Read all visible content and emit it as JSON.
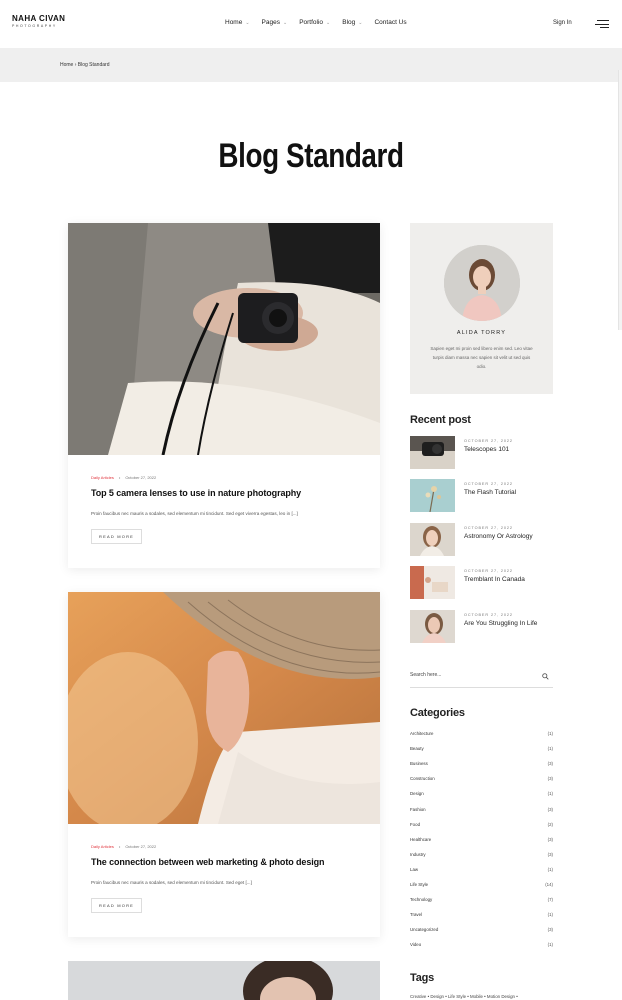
{
  "brand": {
    "name": "NAHA CIVAN",
    "tagline": "PHOTOGRAPHY"
  },
  "nav": [
    {
      "label": "Home",
      "has_dropdown": true
    },
    {
      "label": "Pages",
      "has_dropdown": true
    },
    {
      "label": "Portfolio",
      "has_dropdown": true
    },
    {
      "label": "Blog",
      "has_dropdown": true
    },
    {
      "label": "Contact Us",
      "has_dropdown": false
    }
  ],
  "header": {
    "signin_label": "Sign In",
    "menu_icon": "hamburger-icon"
  },
  "breadcrumb": "Home › Blog Standard",
  "page_title": "Blog Standard",
  "posts": [
    {
      "category": "Daily Articles",
      "date": "October 27, 2022",
      "title": "Top 5 camera lenses to use in nature photography",
      "excerpt": "Proin faucibus nec mauris a sodales, sed elementum mi tincidunt. Sed eget viverra egestas, leo in [...]",
      "read_more": "READ MORE"
    },
    {
      "category": "Daily Articles",
      "date": "October 27, 2022",
      "title": "The connection between web marketing & photo design",
      "excerpt": "Proin faucibus nec mauris a sodales, sed elementum mi tincidunt. Sed eget [...]",
      "read_more": "READ MORE"
    }
  ],
  "author": {
    "name": "ALIDA TORRY",
    "bio": "Sapien eget mi proin sed libero enim sed. Leo vitae turpis diam massa nec sapien sit velit ut sed quis odio."
  },
  "recent_heading": "Recent post",
  "recent_posts": [
    {
      "date": "OCTOBER 27, 2022",
      "title": "Telescopes 101"
    },
    {
      "date": "OCTOBER 27, 2022",
      "title": "The Flash Tutorial"
    },
    {
      "date": "OCTOBER 27, 2022",
      "title": "Astronomy Or Astrology"
    },
    {
      "date": "OCTOBER 27, 2022",
      "title": "Tremblant In Canada"
    },
    {
      "date": "OCTOBER 27, 2022",
      "title": "Are You Struggling In Life"
    }
  ],
  "search": {
    "placeholder": "Search here...",
    "icon": "search-icon"
  },
  "categories_heading": "Categories",
  "categories": [
    {
      "name": "Architecture",
      "count": "(1)"
    },
    {
      "name": "Beauty",
      "count": "(1)"
    },
    {
      "name": "Business",
      "count": "(3)"
    },
    {
      "name": "Construction",
      "count": "(3)"
    },
    {
      "name": "Design",
      "count": "(1)"
    },
    {
      "name": "Fashion",
      "count": "(3)"
    },
    {
      "name": "Food",
      "count": "(2)"
    },
    {
      "name": "Healthcare",
      "count": "(3)"
    },
    {
      "name": "Industry",
      "count": "(3)"
    },
    {
      "name": "Law",
      "count": "(1)"
    },
    {
      "name": "Life Style",
      "count": "(14)"
    },
    {
      "name": "Technology",
      "count": "(7)"
    },
    {
      "name": "Travel",
      "count": "(1)"
    },
    {
      "name": "Uncategorized",
      "count": "(3)"
    },
    {
      "name": "Video",
      "count": "(1)"
    }
  ],
  "tags_heading": "Tags",
  "tags_line": "Creative • Design • Life Style • Mobile • Motion Design •"
}
